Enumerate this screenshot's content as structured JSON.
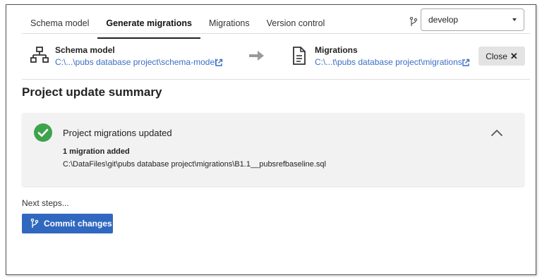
{
  "tabs": [
    {
      "label": "Schema model"
    },
    {
      "label": "Generate migrations"
    },
    {
      "label": "Migrations"
    },
    {
      "label": "Version control"
    }
  ],
  "branch": {
    "selected": "develop",
    "icon": "git-branch-icon"
  },
  "source": {
    "title": "Schema model",
    "path": "C:\\...\\pubs database project\\schema-model",
    "icon": "hierarchy-icon"
  },
  "target": {
    "title": "Migrations",
    "path": "C:\\...t\\pubs database project\\migrations",
    "icon": "document-icon"
  },
  "close_label": "Close",
  "summary_title": "Project update summary",
  "panel": {
    "title": "Project migrations updated",
    "count": "1 migration added",
    "path": "C:\\DataFiles\\git\\pubs database project\\migrations\\B1.1__pubsrefbaseline.sql",
    "status_color": "#3ea34d"
  },
  "next_steps": "Next steps...",
  "commit_label": "Commit changes",
  "accent_color": "#3068c0"
}
